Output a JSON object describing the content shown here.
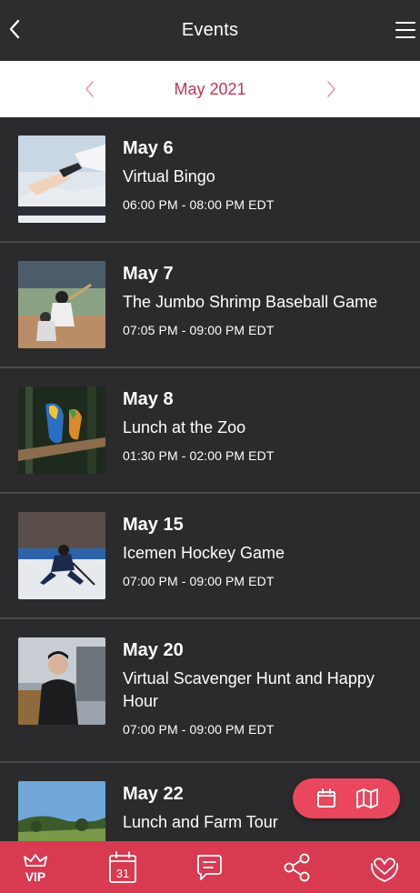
{
  "header": {
    "title": "Events"
  },
  "month_bar": {
    "label": "May 2021"
  },
  "events": [
    {
      "date": "May 6",
      "name": "Virtual Bingo",
      "time": "06:00 PM - 08:00 PM EDT"
    },
    {
      "date": "May 7",
      "name": "The Jumbo Shrimp Baseball Game",
      "time": "07:05 PM - 09:00 PM EDT"
    },
    {
      "date": "May 8",
      "name": "Lunch at the Zoo",
      "time": "01:30 PM - 02:00 PM EDT"
    },
    {
      "date": "May 15",
      "name": "Icemen Hockey Game",
      "time": "07:00 PM - 09:00 PM EDT"
    },
    {
      "date": "May 20",
      "name": "Virtual Scavenger Hunt and Happy Hour",
      "time": "07:00 PM - 09:00 PM EDT"
    },
    {
      "date": "May 22",
      "name": "Lunch and Farm Tour",
      "time": ""
    }
  ],
  "bottom_nav": {
    "vip_label": "VIP",
    "calendar_day": "31"
  },
  "colors": {
    "accent": "#d83a51",
    "toggle": "#e8475e",
    "month_text": "#c9344a",
    "background": "#2b2b2d"
  },
  "icons": [
    "back-icon",
    "menu-icon",
    "chevron-left-icon",
    "chevron-right-icon",
    "calendar-icon",
    "map-icon",
    "crown-icon",
    "chat-icon",
    "share-icon",
    "heart-hands-icon"
  ]
}
